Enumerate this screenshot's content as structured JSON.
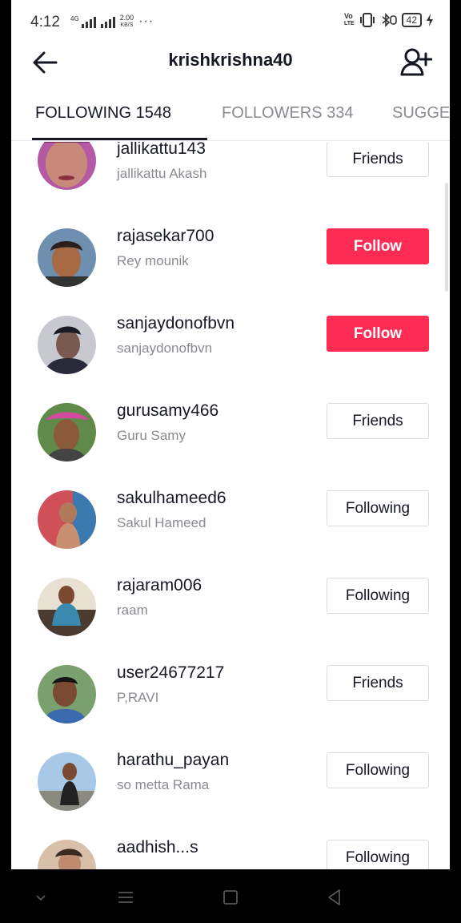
{
  "status_bar": {
    "time": "4:12",
    "network": "4G",
    "speed_value": "2.00",
    "speed_unit": "KB/S",
    "more": "···",
    "volte_top": "Vo",
    "volte_bottom": "LTE",
    "battery": "42"
  },
  "header": {
    "title": "krishkrishna40"
  },
  "tabs": [
    {
      "label": "FOLLOWING 1548",
      "active": true
    },
    {
      "label": "FOLLOWERS 334",
      "active": false
    },
    {
      "label": "SUGGE",
      "active": false
    }
  ],
  "users": [
    {
      "username": "jallikattu143",
      "nickname": "jallikattu Akash",
      "action": "Friends"
    },
    {
      "username": "rajasekar700",
      "nickname": "Rey mounik",
      "action": "Follow"
    },
    {
      "username": "sanjaydonofbvn",
      "nickname": "sanjaydonofbvn",
      "action": "Follow"
    },
    {
      "username": "gurusamy466",
      "nickname": "Guru Samy",
      "action": "Friends"
    },
    {
      "username": "sakulhameed6",
      "nickname": "Sakul Hameed",
      "action": "Following"
    },
    {
      "username": "rajaram006",
      "nickname": "raam",
      "action": "Following"
    },
    {
      "username": "user24677217",
      "nickname": "P,RAVI",
      "action": "Friends"
    },
    {
      "username": "harathu_payan",
      "nickname": "so metta Rama",
      "action": "Following"
    },
    {
      "username": "aadhish...s",
      "nickname": "",
      "action": "Following"
    }
  ],
  "colors": {
    "follow_button": "#fe2c55",
    "text_primary": "#161823",
    "text_secondary": "#8a8b91"
  },
  "icons": {
    "back": "arrow-left-icon",
    "add_user": "person-add-icon",
    "nav_back": "triangle-back-icon",
    "nav_home": "square-home-icon",
    "nav_menu": "menu-lines-icon",
    "nav_down": "chevron-down-icon"
  }
}
